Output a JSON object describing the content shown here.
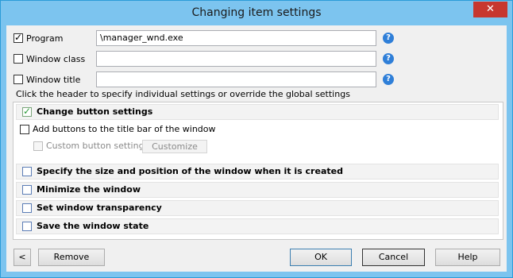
{
  "window": {
    "title": "Changing item settings",
    "close_glyph": "✕"
  },
  "fields": [
    {
      "label": "Program",
      "checked": true,
      "value": "\\manager_wnd.exe"
    },
    {
      "label": "Window class",
      "checked": false,
      "value": ""
    },
    {
      "label": "Window title",
      "checked": false,
      "value": ""
    }
  ],
  "help_glyph": "?",
  "hint": "Click the header to specify individual settings or override the global settings",
  "sections": {
    "change_button": {
      "label": "Change button settings",
      "checked": true
    },
    "add_buttons": {
      "label": "Add buttons to the title bar of the window",
      "checked": false
    },
    "custom_button": {
      "label": "Custom button settings",
      "checked": false
    },
    "customize": "Customize",
    "size_position": {
      "label": "Specify the size and position of the window when it is created",
      "checked": false
    },
    "minimize": {
      "label": "Minimize the window",
      "checked": false
    },
    "transparency": {
      "label": "Set window transparency",
      "checked": false
    },
    "save_state": {
      "label": "Save the window state",
      "checked": false
    }
  },
  "buttons": {
    "back": "<",
    "remove": "Remove",
    "ok": "OK",
    "cancel": "Cancel",
    "help": "Help"
  },
  "colors": {
    "titlebar": "#7cc4ef",
    "close": "#c7372f",
    "help_icon": "#2f7fd8"
  }
}
